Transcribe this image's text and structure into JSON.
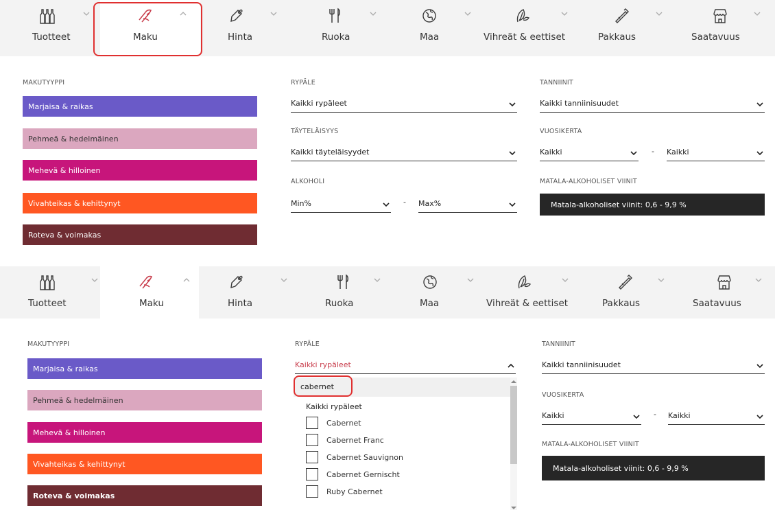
{
  "colors": {
    "highlight": "#e03030",
    "tab_bg": "#f3f3f3",
    "taste_1": "#6a5ac8",
    "taste_2": "#dba7bf",
    "taste_3": "#c7157b",
    "taste_4": "#ff5722",
    "taste_5": "#6f2c32",
    "open_select": "#c83c4b",
    "low_alcohol_button": "#262626"
  },
  "tabs": [
    {
      "label": "Tuotteet",
      "icon": "wine-bottles-icon"
    },
    {
      "label": "Maku",
      "icon": "taste-icon"
    },
    {
      "label": "Hinta",
      "icon": "price-tag-icon"
    },
    {
      "label": "Ruoka",
      "icon": "cutlery-icon"
    },
    {
      "label": "Maa",
      "icon": "globe-icon"
    },
    {
      "label": "Vihreät & eettiset",
      "icon": "leaf-icon"
    },
    {
      "label": "Pakkaus",
      "icon": "package-icon"
    },
    {
      "label": "Saatavuus",
      "icon": "store-icon"
    }
  ],
  "panel_top": {
    "makutyyppi": {
      "label": "MAKUTYYPPI",
      "options": [
        "Marjaisa & raikas",
        "Pehmeä & hedelmäinen",
        "Mehevä & hilloinen",
        "Vivahteikas & kehittynyt",
        "Roteva & voimakas"
      ]
    },
    "rypale": {
      "label": "RYPÄLE",
      "value": "Kaikki rypäleet"
    },
    "tayteläisyys": {
      "label": "TÄYTELÄISYYS",
      "value": "Kaikki täyteläisyydet"
    },
    "alkoholi": {
      "label": "ALKOHOLI",
      "min": "Min%",
      "dash": "-",
      "max": "Max%"
    },
    "tanniinit": {
      "label": "TANNIINIT",
      "value": "Kaikki tanniinisuudet"
    },
    "vuosikerta": {
      "label": "VUOSIKERTA",
      "from": "Kaikki",
      "dash": "-",
      "to": "Kaikki"
    },
    "matala": {
      "label": "MATALA-ALKOHOLISET VIINIT",
      "button": "Matala-alkoholiset viinit: 0,6 - 9,9 %"
    }
  },
  "panel_bottom": {
    "makutyyppi": {
      "label": "MAKUTYYPPI",
      "options": [
        "Marjaisa & raikas",
        "Pehmeä & hedelmäinen",
        "Mehevä & hilloinen",
        "Vivahteikas & kehittynyt",
        "Roteva & voimakas"
      ]
    },
    "rypale": {
      "label": "RYPÄLE",
      "value": "Kaikki rypäleet",
      "search_value": "cabernet",
      "all_option": "Kaikki rypäleet",
      "options": [
        "Cabernet",
        "Cabernet Franc",
        "Cabernet Sauvignon",
        "Cabernet Gernischt",
        "Ruby Cabernet"
      ]
    },
    "tanniinit": {
      "label": "TANNIINIT",
      "value": "Kaikki tanniinisuudet"
    },
    "vuosikerta": {
      "label": "VUOSIKERTA",
      "from": "Kaikki",
      "dash": "-",
      "to": "Kaikki"
    },
    "matala": {
      "label": "MATALA-ALKOHOLISET VIINIT",
      "button": "Matala-alkoholiset viinit: 0,6 - 9,9 %"
    }
  }
}
